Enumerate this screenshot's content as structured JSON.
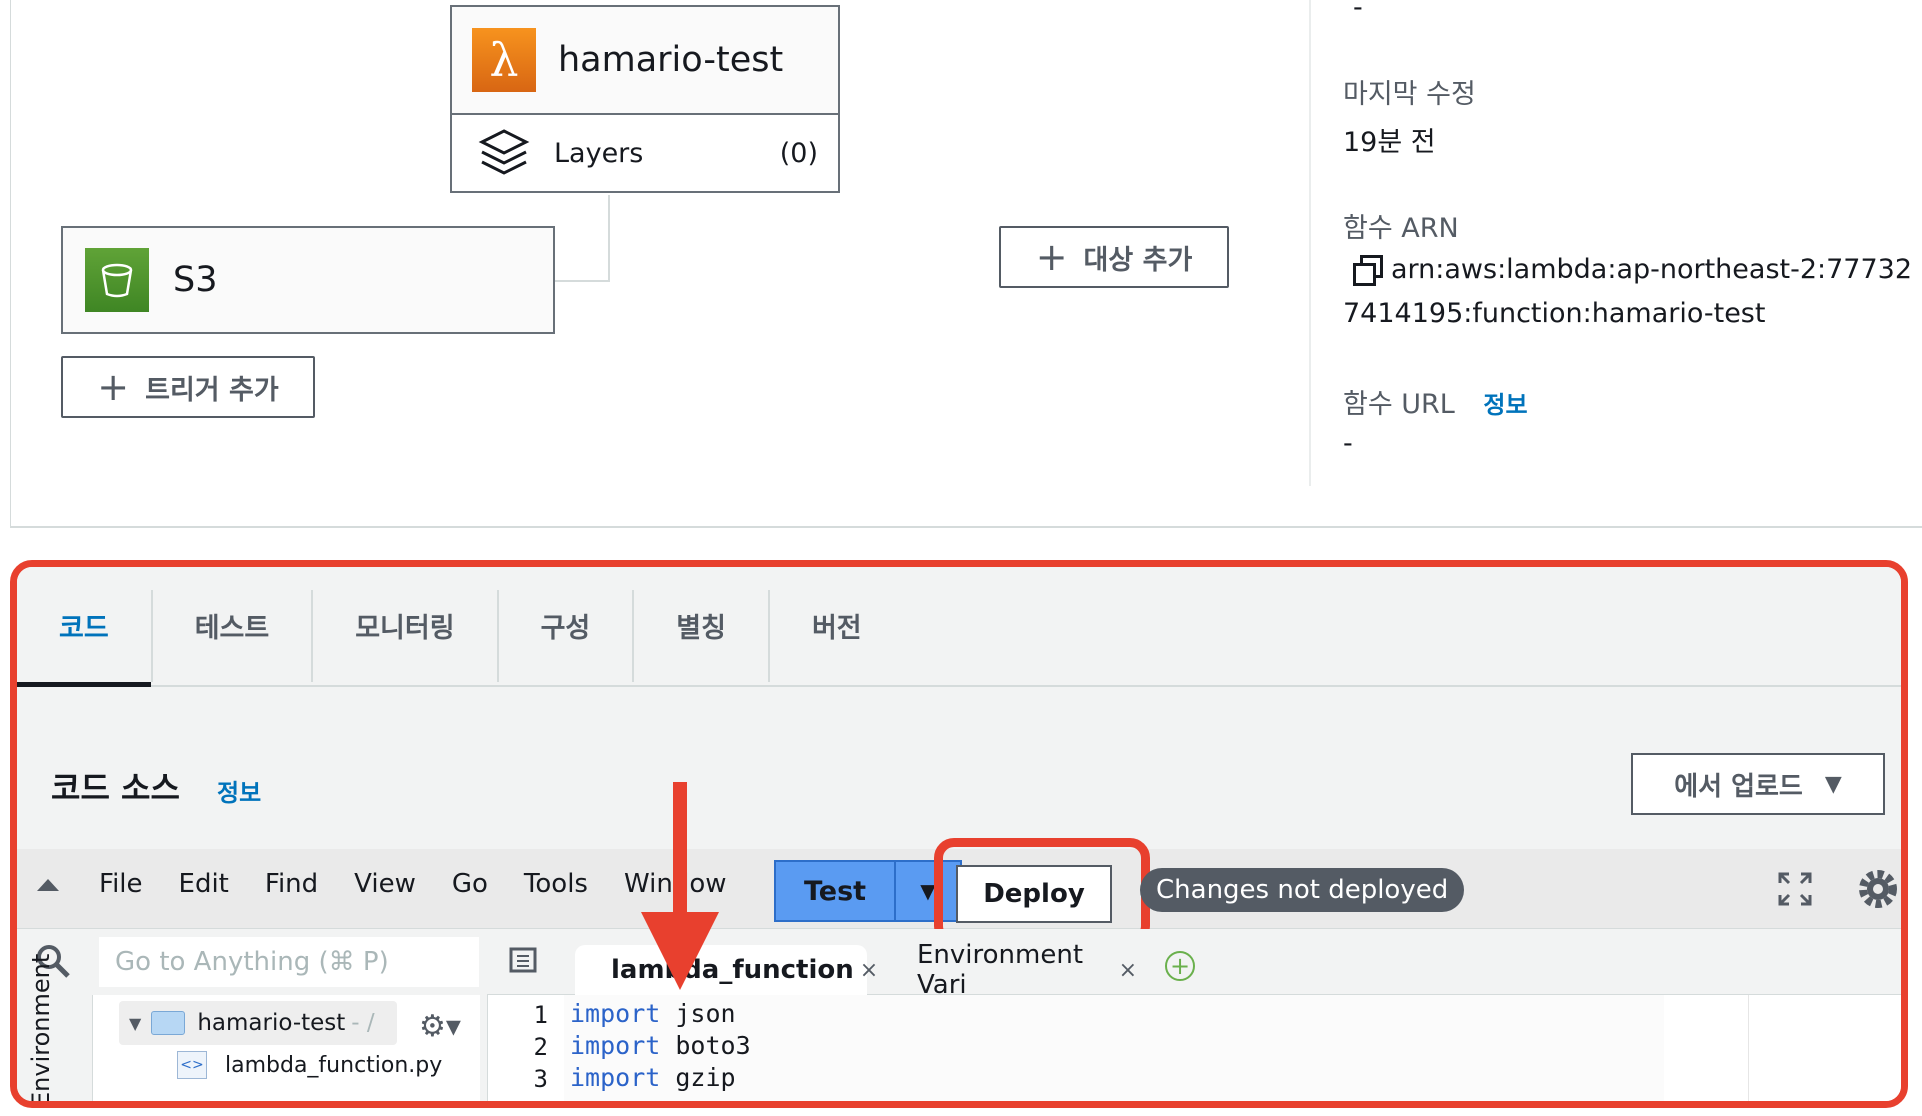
{
  "overview": {
    "function_name": "hamario-test",
    "layers_label": "Layers",
    "layers_count": "(0)",
    "trigger_name": "S3",
    "add_trigger_label": "트리거 추가",
    "add_destination_label": "대상 추가",
    "lambda_symbol": "λ",
    "properties": {
      "top_dash": "-",
      "last_modified_label": "마지막 수정",
      "last_modified_value": "19분 전",
      "arn_label": "함수 ARN",
      "arn_line1": "arn:aws:lambda:ap-northeast-2:77732",
      "arn_line2": "7414195:function:hamario-test",
      "url_label": "함수 URL",
      "url_info": "정보",
      "url_value": "-"
    }
  },
  "tabs": [
    "코드",
    "테스트",
    "모니터링",
    "구성",
    "별칭",
    "버전"
  ],
  "code_source": {
    "title": "코드 소스",
    "info": "정보",
    "upload_label": "에서 업로드"
  },
  "ide": {
    "menu": [
      "File",
      "Edit",
      "Find",
      "View",
      "Go",
      "Tools",
      "Window"
    ],
    "test_label": "Test",
    "deploy_label": "Deploy",
    "status": "Changes not deployed",
    "search_placeholder": "Go to Anything (⌘ P)",
    "tab_active": "lambda_function",
    "tab_inactive": "Environment Vari",
    "env_label": "Environment",
    "tree_root": "hamario-test",
    "tree_root_suffix": "- /",
    "tree_file": "lambda_function.py",
    "code_lines": [
      {
        "num": "1",
        "kw": "import",
        "rest": " json"
      },
      {
        "num": "2",
        "kw": "import",
        "rest": " boto3"
      },
      {
        "num": "3",
        "kw": "import",
        "rest": " gzip"
      }
    ]
  },
  "colors": {
    "highlight": "#e8402e",
    "link": "#0073bb",
    "test_button": "#5a9bf2"
  }
}
